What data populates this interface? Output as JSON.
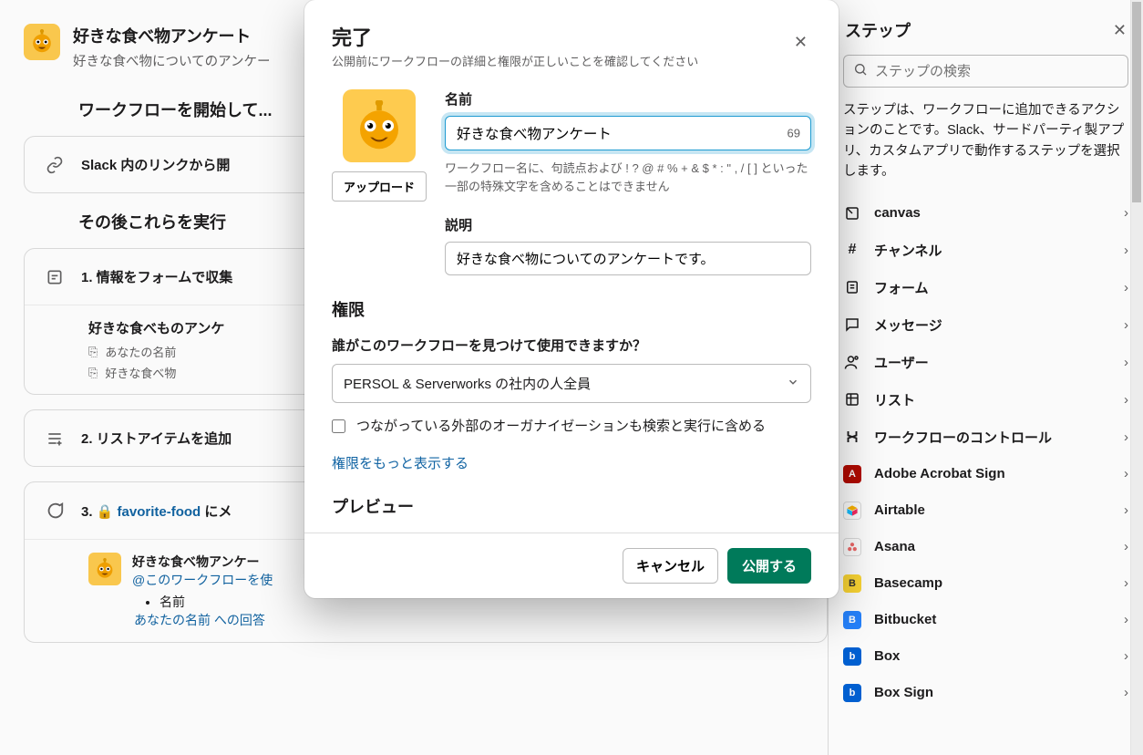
{
  "bg": {
    "title": "好きな食べ物アンケート",
    "subtitle": "好きな食べ物についてのアンケー",
    "section_start": "ワークフローを開始して...",
    "start_step": "Slack 内のリンクから開",
    "section_then": "その後これらを実行",
    "step1": "1. 情報をフォームで収集",
    "step1_sub_title": "好きな食べものアンケ",
    "step1_sub_l1": "あなたの名前",
    "step1_sub_l2": "好きな食べ物",
    "step2": "2. リストアイテムを追加",
    "step3_prefix": "3. ",
    "step3_lock": "🔒",
    "step3_channel": "favorite-food",
    "step3_suffix": " にメ",
    "preview_title": "好きな食べ物アンケー",
    "preview_link": "@このワークフローを使",
    "preview_field1": "名前",
    "preview_answer": "あなたの名前 への回答"
  },
  "right": {
    "title": "ステップ",
    "search_placeholder": "ステップの検索",
    "desc": "ステップは、ワークフローに追加できるアクションのことです。Slack、サードパーティ製アプリ、カスタムアプリで動作するステップを選択します。",
    "items": [
      "canvas",
      "チャンネル",
      "フォーム",
      "メッセージ",
      "ユーザー",
      "リスト",
      "ワークフローのコントロール",
      "Adobe Acrobat Sign",
      "Airtable",
      "Asana",
      "Basecamp",
      "Bitbucket",
      "Box",
      "Box Sign"
    ]
  },
  "modal": {
    "title": "完了",
    "subtitle": "公開前にワークフローの詳細と権限が正しいことを確認してください",
    "upload": "アップロード",
    "name_label": "名前",
    "name_value": "好きな食べ物アンケート",
    "char_count": "69",
    "name_hint": "ワークフロー名に、句読点および ! ? @ # % + & $ * : \" , / [ ] といった一部の特殊文字を含めることはできません",
    "desc_label": "説明",
    "desc_value": "好きな食べ物についてのアンケートです。",
    "perm_title": "権限",
    "perm_label": "誰がこのワークフローを見つけて使用できますか？",
    "perm_select": "PERSOL & Serverworks の社内の人全員",
    "perm_check": "つながっている外部のオーガナイゼーションも検索と実行に含める",
    "perm_more": "権限をもっと表示する",
    "preview_title": "プレビュー",
    "cancel": "キャンセル",
    "publish": "公開する"
  }
}
